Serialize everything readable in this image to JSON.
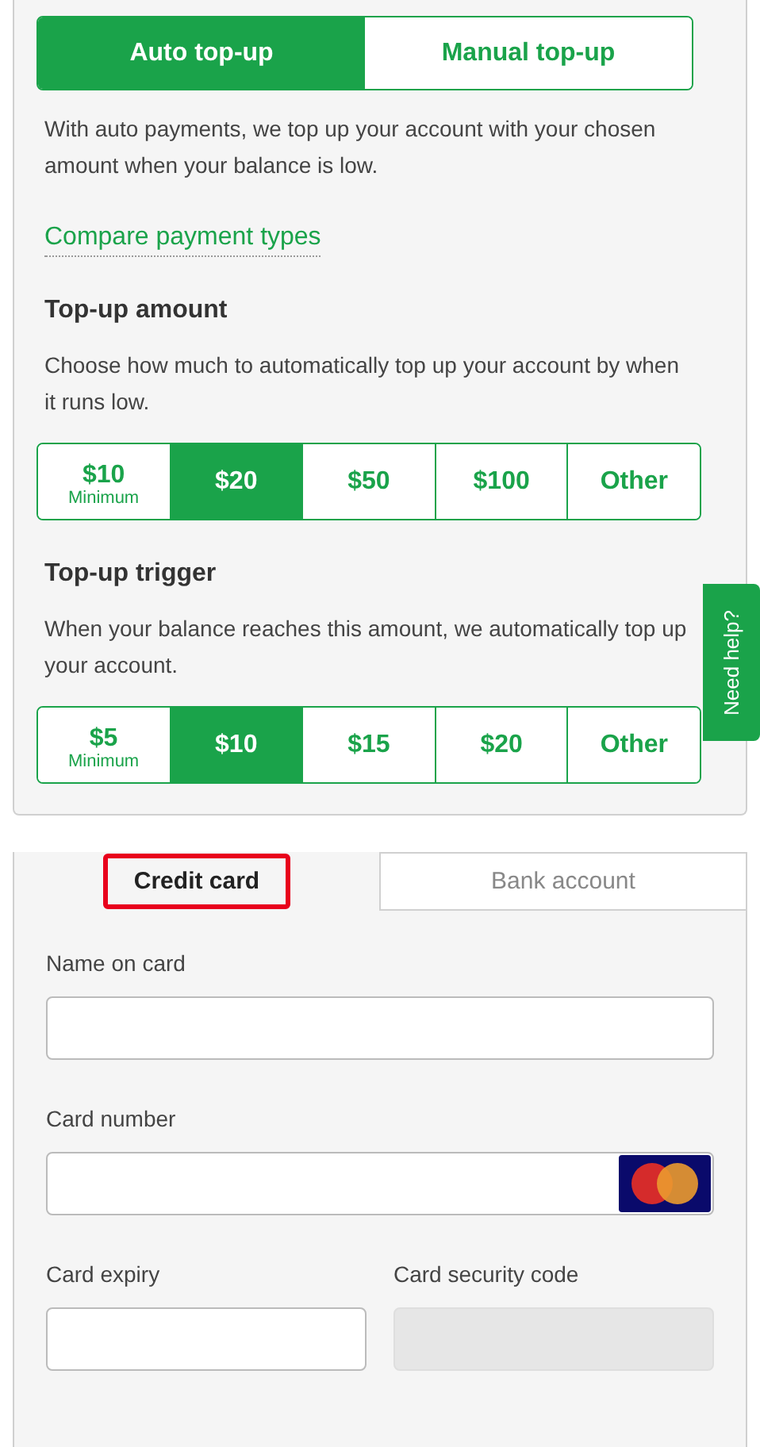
{
  "mode_toggle": [
    {
      "label": "Auto top-up",
      "selected": true
    },
    {
      "label": "Manual top-up",
      "selected": false
    }
  ],
  "intro": "With auto payments, we top up your account with your chosen amount when your balance is low.",
  "compare_link": "Compare payment types",
  "sections": [
    {
      "heading": "Top-up amount",
      "description": "Choose how much to automatically top up your account by when it runs low.",
      "options": [
        {
          "label": "$10",
          "note": "Minimum",
          "selected": false
        },
        {
          "label": "$20",
          "selected": true
        },
        {
          "label": "$50",
          "selected": false
        },
        {
          "label": "$100",
          "selected": false
        },
        {
          "label": "Other",
          "selected": false
        }
      ]
    },
    {
      "heading": "Top-up trigger",
      "description": "When your balance reaches this amount, we automatically top up your account.",
      "options": [
        {
          "label": "$5",
          "note": "Minimum",
          "selected": false
        },
        {
          "label": "$10",
          "selected": true
        },
        {
          "label": "$15",
          "selected": false
        },
        {
          "label": "$20",
          "selected": false
        },
        {
          "label": "Other",
          "selected": false
        }
      ]
    }
  ],
  "help_tab": "Need help?",
  "payment_tabs": [
    {
      "label": "Credit card",
      "selected": true,
      "highlighted": true
    },
    {
      "label": "Bank account",
      "selected": false,
      "highlighted": false
    }
  ],
  "fields": [
    {
      "label": "Name on card",
      "kind": "text",
      "disabled": false
    },
    {
      "label": "Card number",
      "kind": "card",
      "disabled": false
    }
  ],
  "field_pair": [
    {
      "label": "Card expiry",
      "disabled": false
    },
    {
      "label": "Card security code",
      "disabled": true
    }
  ]
}
